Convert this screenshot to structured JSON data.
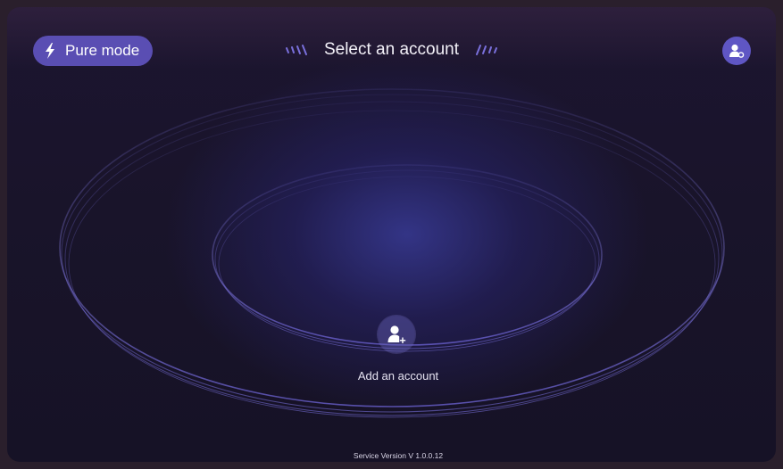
{
  "header": {
    "pure_mode_label": "Pure mode",
    "title": "Select an account"
  },
  "main": {
    "add_account_label": "Add an account"
  },
  "footer": {
    "version": "Service Version V 1.0.0.12"
  },
  "icons": {
    "pure_mode": "lightning-bolt-icon",
    "account_settings": "account-settings-icon",
    "add_account": "add-user-icon",
    "title_left": "stripes-left-icon",
    "title_right": "stripes-right-icon"
  },
  "colors": {
    "accent": "#5a4eb3",
    "background": "#19142a",
    "ring": "#6e64d8"
  }
}
